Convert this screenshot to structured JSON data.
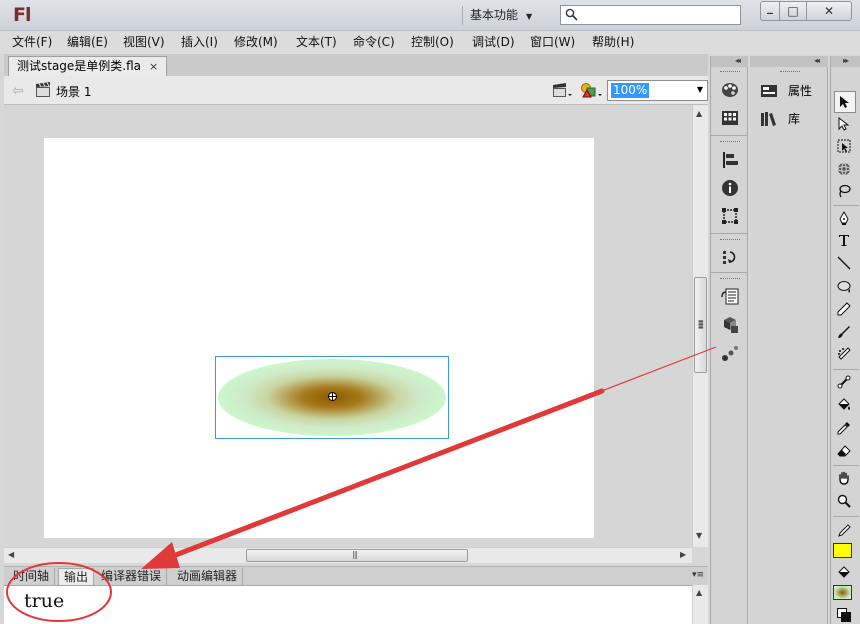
{
  "app": {
    "logo": "Fl",
    "workspace": "基本功能"
  },
  "menu": [
    "文件(F)",
    "编辑(E)",
    "视图(V)",
    "插入(I)",
    "修改(M)",
    "文本(T)",
    "命令(C)",
    "控制(O)",
    "调试(D)",
    "窗口(W)",
    "帮助(H)"
  ],
  "document": {
    "tab_title": "测试stage是单例类.fla",
    "close_glyph": "×"
  },
  "editbar": {
    "scene": "场景 1",
    "zoom": "100%"
  },
  "bottom_panel": {
    "tabs": [
      "时间轴",
      "输出",
      "编译器错误",
      "动画编辑器"
    ],
    "active_tab": "输出",
    "output_text": "true"
  },
  "side_panel": {
    "items": [
      "属性",
      "库"
    ]
  },
  "colors": {
    "accent_blue": "#3399ff",
    "stroke_color": "#ffff00",
    "annotation_red": "#e0393a",
    "selection_box": "#3a9bd8"
  },
  "icons": {
    "panel_strip": [
      "color-icon",
      "swatches-icon",
      "align-icon",
      "info-icon",
      "transform-icon",
      "history-icon",
      "code-snippets-icon",
      "components-icon",
      "motion-presets-icon"
    ],
    "tools": [
      "selection-tool-icon",
      "subselection-tool-icon",
      "free-transform-tool-icon",
      "3d-rotation-tool-icon",
      "lasso-tool-icon",
      "pen-tool-icon",
      "text-tool-icon",
      "line-tool-icon",
      "oval-tool-icon",
      "pencil-tool-icon",
      "brush-tool-icon",
      "deco-tool-icon",
      "bone-tool-icon",
      "paint-bucket-tool-icon",
      "eyedropper-tool-icon",
      "eraser-tool-icon",
      "hand-tool-icon",
      "zoom-tool-icon",
      "stroke-color-icon",
      "fill-color-icon"
    ]
  }
}
